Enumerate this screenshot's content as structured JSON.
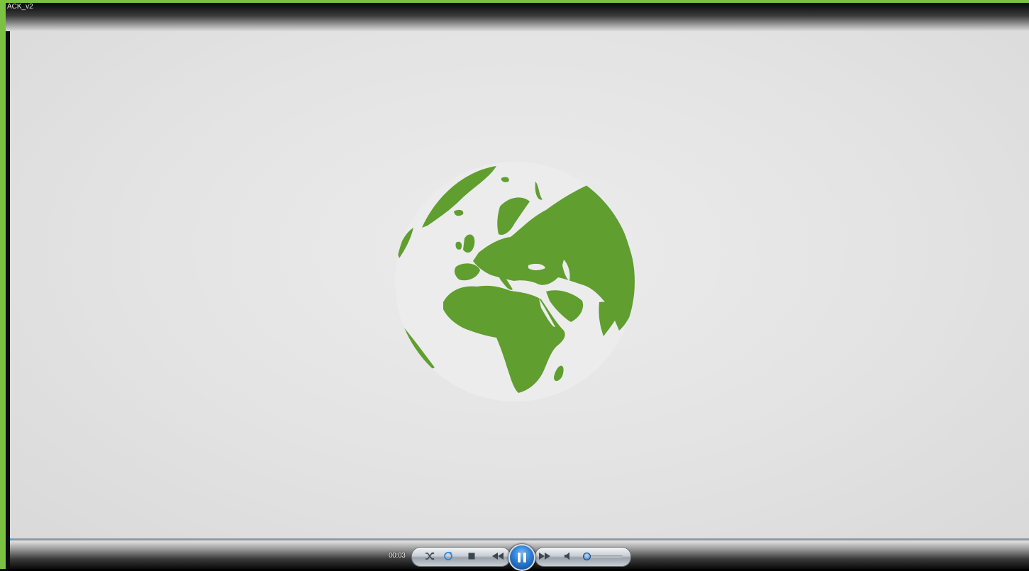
{
  "window": {
    "title": "ACK_v2"
  },
  "player": {
    "elapsed": "00:03",
    "seek_progress": 0.0,
    "volume_level": 0.08,
    "state": "playing"
  },
  "icons": {
    "shuffle": "shuffle-icon",
    "repeat": "repeat-icon",
    "stop": "stop-icon",
    "previous": "previous-icon",
    "play_pause": "pause-icon",
    "next": "next-icon",
    "mute": "speaker-icon"
  },
  "colors": {
    "frame_accent": "#7cc242",
    "globe_land": "#5f9e2f",
    "globe_ocean": "#ececec",
    "video_background": "#e3e3e3",
    "seek_fill": "#3aa2e8"
  }
}
